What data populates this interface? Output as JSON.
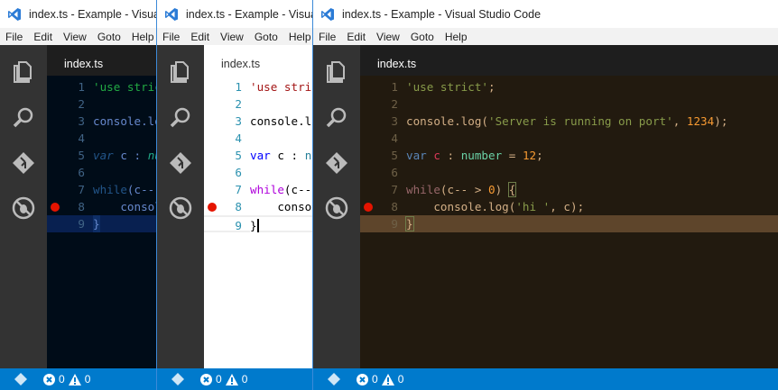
{
  "windows": [
    {
      "id": "w1",
      "theme": "abyss",
      "title": "index.ts - Example - Visual Studio Code",
      "tab": "index.ts"
    },
    {
      "id": "w2",
      "theme": "light",
      "title": "index.ts - Example - Visual Studio Code",
      "tab": "index.ts"
    },
    {
      "id": "w3",
      "theme": "kimbie",
      "title": "index.ts - Example - Visual Studio Code",
      "tab": "index.ts"
    }
  ],
  "menu": [
    "File",
    "Edit",
    "View",
    "Goto",
    "Help"
  ],
  "code": {
    "breakpoint_line": 8,
    "current_line": 9,
    "lines": [
      [
        [
          "str",
          "'use strict'"
        ],
        [
          "p",
          ";"
        ]
      ],
      [],
      [
        [
          "fn",
          "console.log("
        ],
        [
          "str",
          "'Server is running on port'"
        ],
        [
          "p",
          ", "
        ],
        [
          "num",
          "1234"
        ],
        [
          "p",
          ");"
        ]
      ],
      [],
      [
        [
          "kw",
          "var"
        ],
        [
          "p",
          " "
        ],
        [
          "var",
          "c"
        ],
        [
          "p",
          " : "
        ],
        [
          "type",
          "number"
        ],
        [
          "p",
          " = "
        ],
        [
          "num",
          "12"
        ],
        [
          "p",
          ";"
        ]
      ],
      [],
      [
        [
          "ctl",
          "while"
        ],
        [
          "p",
          "(c-- > "
        ],
        [
          "num",
          "0"
        ],
        [
          "p",
          ") "
        ],
        [
          "brace",
          "{"
        ]
      ],
      [
        [
          "p",
          "    console.log("
        ],
        [
          "str",
          "'hi '"
        ],
        [
          "p",
          ", c);"
        ]
      ],
      [
        [
          "brace",
          "}"
        ]
      ]
    ]
  },
  "status": {
    "errors": "0",
    "warnings": "0"
  },
  "colors": {
    "status_bar": "#007acc",
    "activity_bar": "#333333",
    "breakpoint": "#e51400"
  }
}
